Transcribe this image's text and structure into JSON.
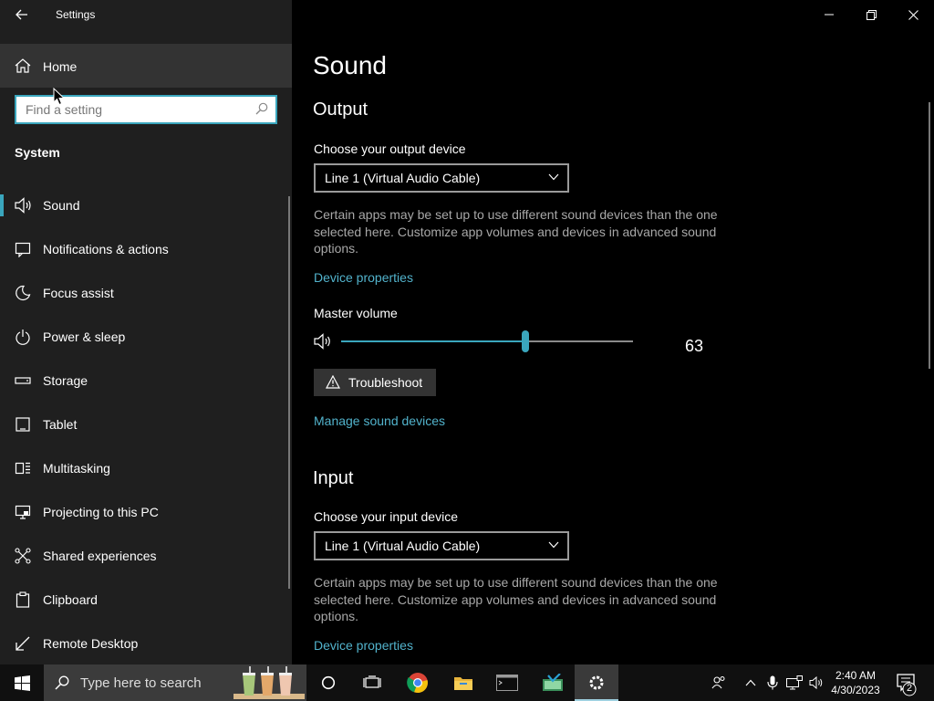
{
  "window": {
    "title": "Settings",
    "controls": [
      "minimize",
      "restore",
      "close"
    ]
  },
  "sidebar": {
    "home_label": "Home",
    "search_placeholder": "Find a setting",
    "group_title": "System",
    "items": [
      {
        "label": "Sound",
        "icon": "speaker-icon",
        "active": true
      },
      {
        "label": "Notifications & actions",
        "icon": "notification-icon"
      },
      {
        "label": "Focus assist",
        "icon": "moon-icon"
      },
      {
        "label": "Power & sleep",
        "icon": "power-icon"
      },
      {
        "label": "Storage",
        "icon": "storage-icon"
      },
      {
        "label": "Tablet",
        "icon": "tablet-icon"
      },
      {
        "label": "Multitasking",
        "icon": "multitasking-icon"
      },
      {
        "label": "Projecting to this PC",
        "icon": "projecting-icon"
      },
      {
        "label": "Shared experiences",
        "icon": "shared-experiences-icon"
      },
      {
        "label": "Clipboard",
        "icon": "clipboard-icon"
      },
      {
        "label": "Remote Desktop",
        "icon": "remote-desktop-icon"
      }
    ]
  },
  "main": {
    "page_title": "Sound",
    "output": {
      "heading": "Output",
      "device_label": "Choose your output device",
      "device_value": "Line 1 (Virtual Audio Cable)",
      "description": "Certain apps may be set up to use different sound devices than the one selected here. Customize app volumes and devices in advanced sound options.",
      "device_properties_link": "Device properties",
      "master_volume_label": "Master volume",
      "master_volume_value": "63",
      "master_volume_fraction": 0.63,
      "troubleshoot_label": "Troubleshoot",
      "manage_link": "Manage sound devices"
    },
    "input": {
      "heading": "Input",
      "device_label": "Choose your input device",
      "device_value": "Line 1 (Virtual Audio Cable)",
      "description": "Certain apps may be set up to use different sound devices than the one selected here. Customize app volumes and devices in advanced sound options.",
      "device_properties_link": "Device properties"
    }
  },
  "taskbar": {
    "search_placeholder": "Type here to search",
    "pinned": [
      "cortana-icon",
      "task-view-icon",
      "chrome-icon",
      "file-explorer-icon",
      "terminal-icon",
      "virtual-cable-icon",
      "settings-icon"
    ],
    "tray_icons": [
      "people-icon",
      "chevron-up-icon",
      "microphone-icon",
      "network-icon",
      "volume-icon"
    ],
    "time": "2:40 AM",
    "date": "4/30/2023",
    "notification_count": "2"
  },
  "colors": {
    "accent": "#3aa6bd",
    "link": "#52b3cc",
    "sidebar_bg": "#1f1f1f",
    "content_bg": "#000000",
    "taskbar_bg": "#101010"
  }
}
